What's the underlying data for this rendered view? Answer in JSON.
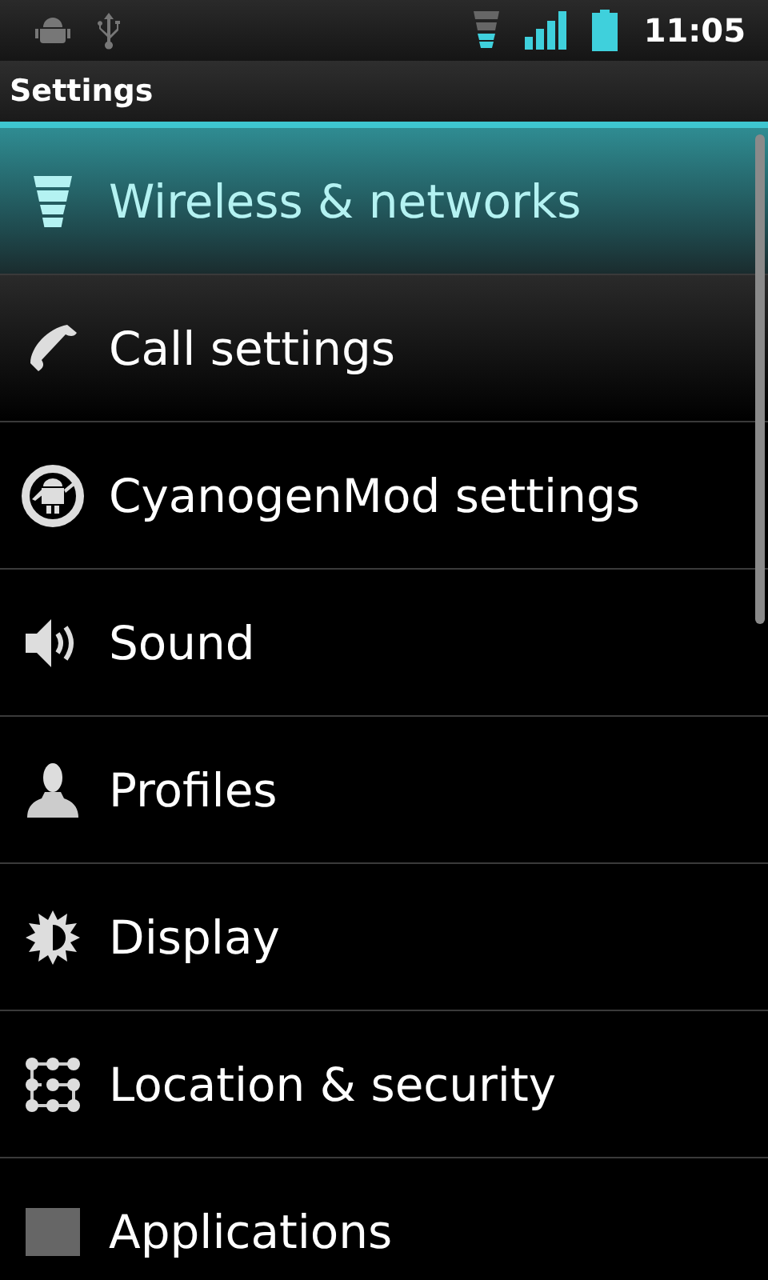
{
  "status_bar": {
    "time": "11:05"
  },
  "title_bar": {
    "title": "Settings"
  },
  "items": [
    {
      "label": "Wireless & networks",
      "selected": true
    },
    {
      "label": "Call settings",
      "selected": false
    },
    {
      "label": "CyanogenMod settings",
      "selected": false
    },
    {
      "label": "Sound",
      "selected": false
    },
    {
      "label": "Profiles",
      "selected": false
    },
    {
      "label": "Display",
      "selected": false
    },
    {
      "label": "Location & security",
      "selected": false
    },
    {
      "label": "Applications",
      "selected": false
    }
  ]
}
